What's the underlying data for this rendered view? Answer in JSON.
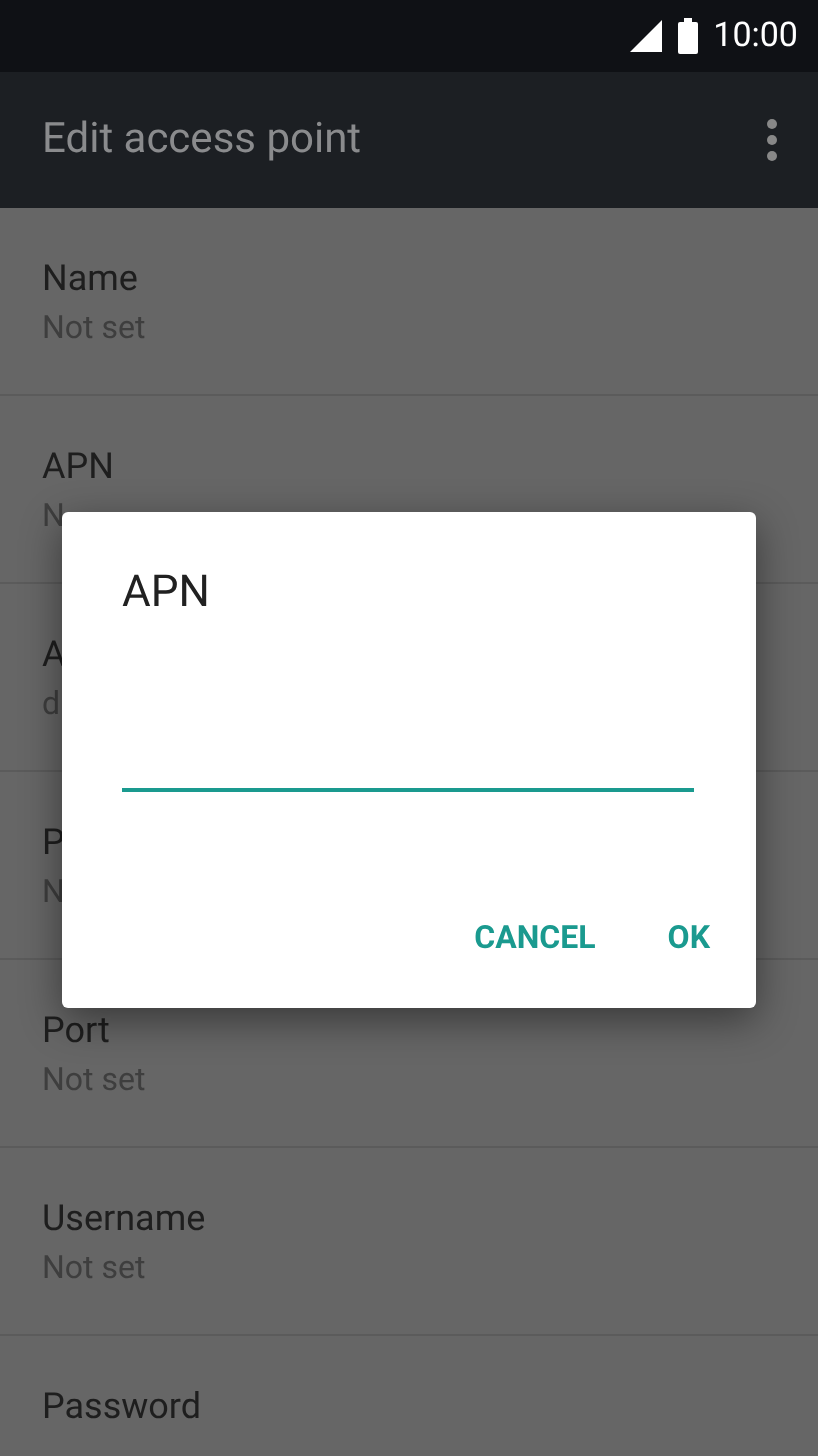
{
  "status_bar": {
    "time": "10:00"
  },
  "app_bar": {
    "title": "Edit access point"
  },
  "settings": [
    {
      "title": "Name",
      "value": "Not set"
    },
    {
      "title": "APN",
      "value": "N"
    },
    {
      "title": "A",
      "value": "d"
    },
    {
      "title": "P",
      "value": "N"
    },
    {
      "title": "Port",
      "value": "Not set"
    },
    {
      "title": "Username",
      "value": "Not set"
    },
    {
      "title": "Password"
    }
  ],
  "dialog": {
    "title": "APN",
    "field": {
      "focused": true
    },
    "buttons": [
      "CANCEL",
      "OK"
    ]
  }
}
